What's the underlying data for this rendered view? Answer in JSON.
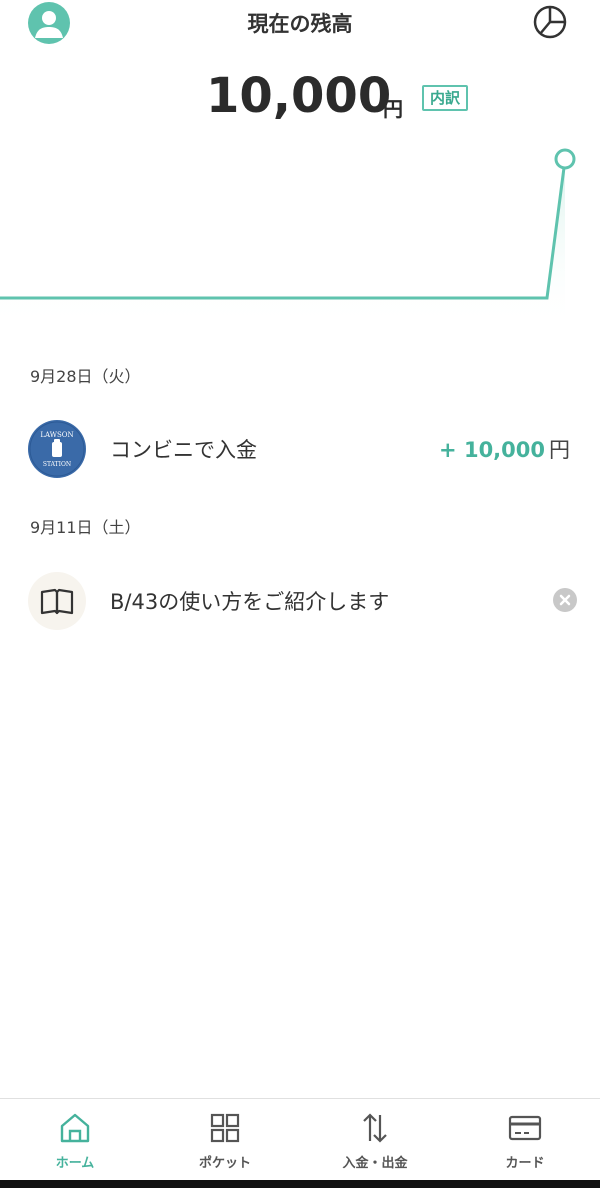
{
  "header": {
    "title": "現在の残高",
    "avatar_icon": "user-avatar-icon",
    "chart_icon": "pie-chart-icon"
  },
  "balance": {
    "amount": "10,000",
    "unit": "円",
    "breakdown_label": "内訳"
  },
  "transactions": [
    {
      "date": "9月28日（火）",
      "title": "コンビニで入金",
      "amount": "+ 10,000",
      "unit": "円",
      "icon": "lawson-station-icon",
      "logo_text_top": "LAWSON",
      "logo_text_bottom": "STATION"
    },
    {
      "date": "9月11日（土）",
      "title": "B/43の使い方をご紹介します",
      "icon": "book-icon",
      "action_icon": "dismiss-icon"
    }
  ],
  "tabbar": {
    "tabs": [
      {
        "label": "ホーム",
        "icon": "home-icon",
        "active": true
      },
      {
        "label": "ポケット",
        "icon": "grid-icon",
        "active": false
      },
      {
        "label": "入金・出金",
        "icon": "transfer-arrows-icon",
        "active": false
      },
      {
        "label": "カード",
        "icon": "card-icon",
        "active": false
      }
    ]
  },
  "colors": {
    "accent": "#5fc3ae",
    "amount_positive": "#45b29c",
    "lawson_blue": "#3a6aa8"
  }
}
